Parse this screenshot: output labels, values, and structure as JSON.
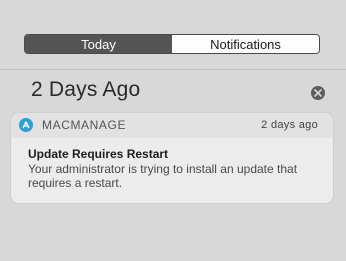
{
  "tabs": {
    "today": "Today",
    "notifications": "Notifications"
  },
  "section": {
    "title": "2 Days Ago"
  },
  "notification": {
    "app_name": "MACMANAGE",
    "time": "2 days ago",
    "title": "Update Requires Restart",
    "body": "Your administrator is trying to install an update that requires a restart."
  },
  "colors": {
    "background": "#d8d8d8",
    "active_tab": "#545454",
    "app_icon": "#2e9fd6"
  },
  "icons": {
    "clear": "close-circle-icon",
    "app": "macmanage-app-icon"
  }
}
